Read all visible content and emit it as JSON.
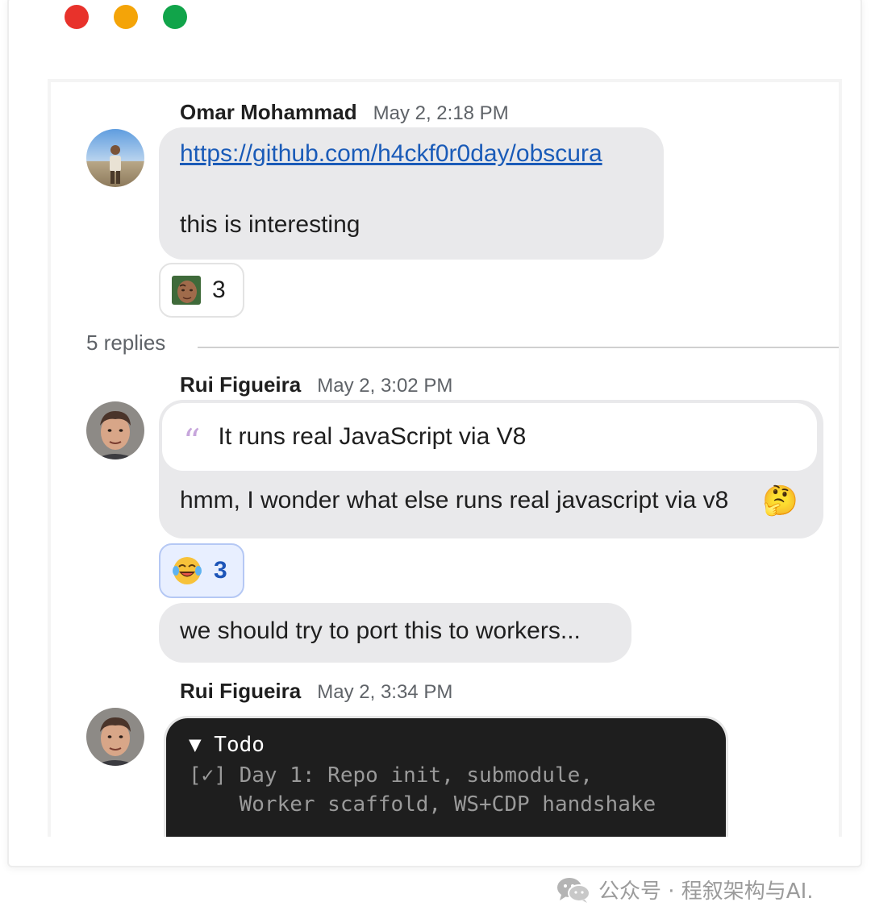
{
  "window": {
    "controls": [
      "close",
      "minimize",
      "maximize"
    ]
  },
  "messages": [
    {
      "sender": "Omar Mohammad",
      "timestamp": "May 2, 2:18 PM",
      "link": "https://github.com/h4ckf0r0day/obscura",
      "text": "this is interesting",
      "reaction": {
        "icon": "the-rock-face-emoji",
        "count": "3"
      }
    }
  ],
  "thread": {
    "replies_label": "5 replies",
    "replies": [
      {
        "sender": "Rui Figueira",
        "timestamp": "May 2, 3:02 PM",
        "quote": "It runs real JavaScript via V8",
        "text": "hmm, I wonder what else runs real javascript via v8",
        "emoji": "🤔",
        "reaction": {
          "icon": "laughing-tears-emoji",
          "count": "3"
        },
        "followup": "we should try to port this to workers..."
      },
      {
        "sender": "Rui Figueira",
        "timestamp": "May 2, 3:34 PM",
        "code": {
          "title": "▼ Todo",
          "lines": [
            "[✓] Day 1: Repo init, submodule,",
            "    Worker scaffold, WS+CDP handshake"
          ]
        }
      }
    ]
  },
  "watermark": {
    "text": "公众号 · 程叙架构与AI."
  },
  "colors": {
    "bubble": "#e9e9eb",
    "link": "#1a5bb8",
    "active_reaction_bg": "#e8efff",
    "code_bg": "#1e1e1e"
  }
}
